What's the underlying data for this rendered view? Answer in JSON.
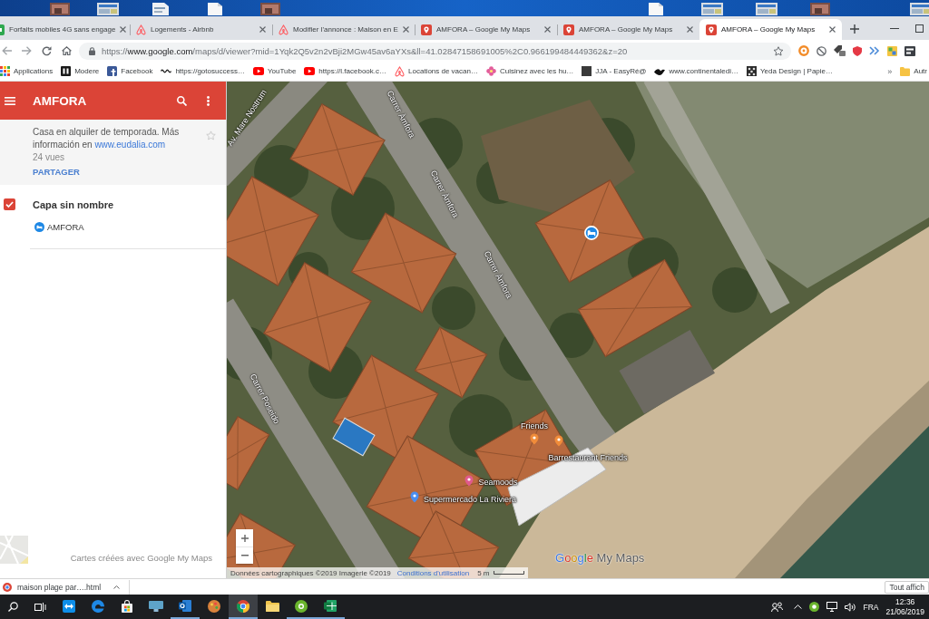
{
  "desktop": {
    "icons": [
      {
        "kind": "photo"
      },
      {
        "kind": "window"
      },
      {
        "kind": "document"
      },
      {
        "kind": "page"
      },
      {
        "kind": "photo"
      },
      {
        "kind": "page"
      },
      {
        "kind": "window"
      },
      {
        "kind": "window"
      },
      {
        "kind": "photo"
      },
      {
        "kind": "window"
      }
    ]
  },
  "tabs": [
    {
      "title": "Forfaits mobiles 4G sans engage",
      "kind": "mobile",
      "selected": false
    },
    {
      "title": "Logements - Airbnb",
      "kind": "airbnb",
      "selected": false
    },
    {
      "title": "Modifier l'annonce : Maison en E",
      "kind": "airbnb",
      "selected": false
    },
    {
      "title": "AMFORA – Google My Maps",
      "kind": "mymaps",
      "selected": false
    },
    {
      "title": "AMFORA – Google My Maps",
      "kind": "mymaps",
      "selected": false
    },
    {
      "title": "AMFORA – Google My Maps",
      "kind": "mymaps",
      "selected": true
    }
  ],
  "address_bar": {
    "scheme": "https://",
    "host": "www.google.com",
    "path": "/maps/d/viewer?mid=1Yqk2Q5v2n2vBji2MGw45av6aYXs&ll=41.02847158691005%2C0.966199484449362&z=20"
  },
  "bookmarks": {
    "items": [
      {
        "label": "Applications",
        "kind": "apps"
      },
      {
        "label": "Modere",
        "kind": "dark-tile"
      },
      {
        "label": "Facebook",
        "kind": "facebook"
      },
      {
        "label": "https://gotosuccess…",
        "kind": "wix"
      },
      {
        "label": "YouTube",
        "kind": "youtube"
      },
      {
        "label": "https://l.facebook.c…",
        "kind": "youtube"
      },
      {
        "label": "Locations de vacan…",
        "kind": "airbnb"
      },
      {
        "label": "Cuisinez avec les hu…",
        "kind": "flower"
      },
      {
        "label": "JJA - EasyRé@",
        "kind": "plain-tile"
      },
      {
        "label": "www.continentaledi…",
        "kind": "bird"
      },
      {
        "label": "Yeda Design | Papie…",
        "kind": "pattern"
      }
    ],
    "overflow": "»",
    "folder": "Autr"
  },
  "mymaps": {
    "title": "AMFORA",
    "description": "Casa en alquiler de temporada. Más información en",
    "link": "www.eudalia.com",
    "views": "24 vues",
    "share": "PARTAGER",
    "layers": [
      {
        "name": "Capa sin nombre",
        "checked": true,
        "features": [
          {
            "label": "AMFORA",
            "color": "#1e88e5"
          }
        ]
      }
    ],
    "credit": "Cartes créées avec Google My Maps"
  },
  "map": {
    "streets": [
      "Av. Mare Nostrum",
      "Carrer Àmfora",
      "Carrer Àmfora",
      "Carrer Àmfora",
      "Carrer Poseido"
    ],
    "places": [
      {
        "label": "Friends",
        "color": "#f08c3a"
      },
      {
        "label": "Barrestaurant Friends",
        "color": "#f08c3a"
      },
      {
        "label": "Seamoods",
        "color": "#e05a8c"
      },
      {
        "label": "Supermercado La Riviera",
        "color": "#4a8ef0"
      }
    ],
    "attribution": "Données cartographiques ©2019 Imagerie ©2019",
    "terms": "Conditions d'utilisation",
    "scale": "5 m",
    "logo": "Google My Maps"
  },
  "downloads": {
    "items": [
      {
        "name": "maison plage par….html"
      }
    ],
    "show_all": "Tout affich"
  },
  "taskbar": {
    "apps": [
      {
        "kind": "teamviewer",
        "running": false,
        "selected": false
      },
      {
        "kind": "edge",
        "running": false,
        "selected": false
      },
      {
        "kind": "store",
        "running": false,
        "selected": false
      },
      {
        "kind": "monitor",
        "running": false,
        "selected": false
      },
      {
        "kind": "outlook",
        "running": true,
        "selected": false
      },
      {
        "kind": "paint",
        "running": false,
        "selected": false
      },
      {
        "kind": "chrome",
        "running": true,
        "selected": true
      },
      {
        "kind": "files",
        "running": false,
        "selected": false
      },
      {
        "kind": "torrent",
        "running": true,
        "selected": false
      },
      {
        "kind": "excel",
        "running": true,
        "selected": false
      }
    ],
    "language": "FRA",
    "time": "12:36",
    "date": "21/06/2019"
  }
}
